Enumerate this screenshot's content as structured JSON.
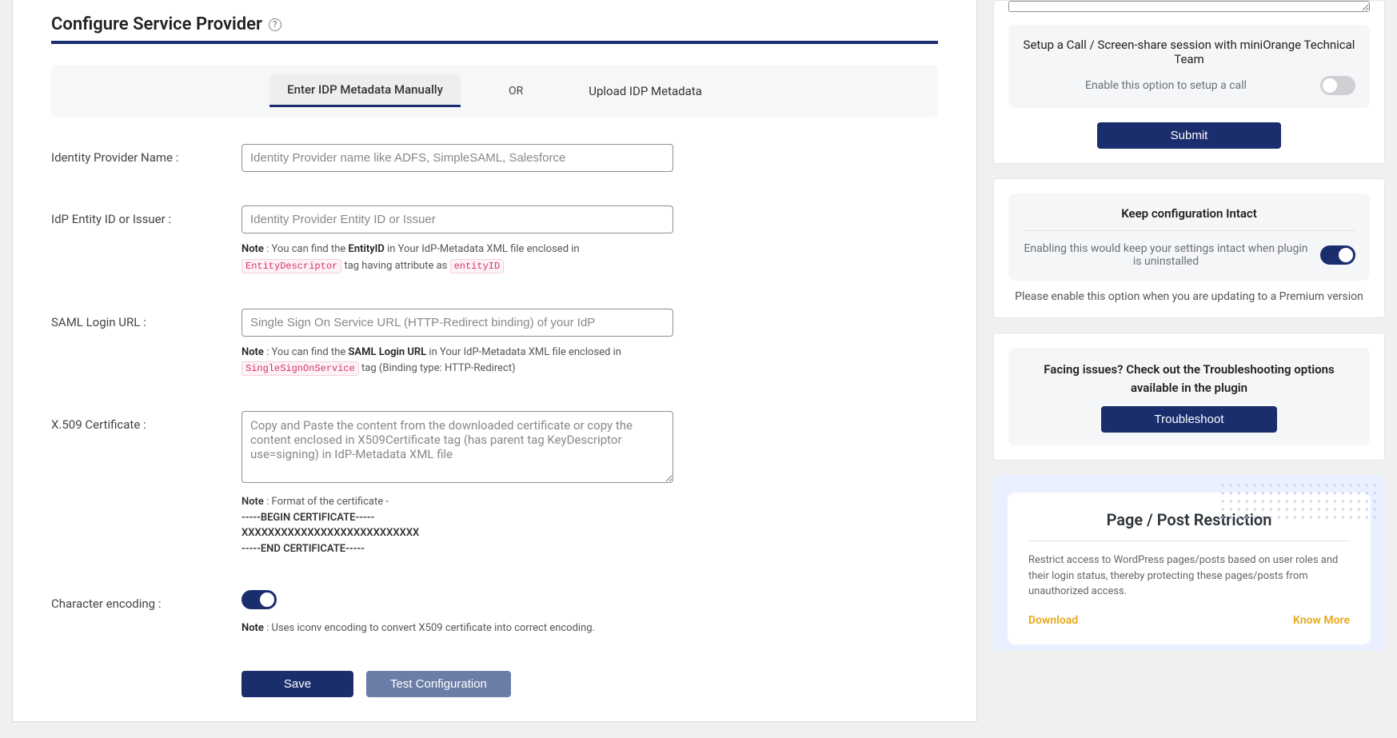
{
  "header": {
    "title": "Configure Service Provider",
    "help_glyph": "?"
  },
  "tabs": {
    "manual": "Enter IDP Metadata Manually",
    "or": "OR",
    "upload": "Upload IDP Metadata"
  },
  "form": {
    "idp_name": {
      "label": "Identity Provider Name :",
      "placeholder": "Identity Provider name like ADFS, SimpleSAML, Salesforce"
    },
    "entity_id": {
      "label": "IdP Entity ID or Issuer :",
      "placeholder": "Identity Provider Entity ID or Issuer",
      "note_prefix": "Note",
      "note_1": " : You can find the ",
      "note_bold": "EntityID",
      "note_2": " in Your IdP-Metadata XML file enclosed in ",
      "note_code1": "EntityDescriptor",
      "note_3": " tag having attribute as ",
      "note_code2": "entityID"
    },
    "login_url": {
      "label": "SAML Login URL :",
      "placeholder": "Single Sign On Service URL (HTTP-Redirect binding) of your IdP",
      "note_prefix": "Note",
      "note_1": " : You can find the ",
      "note_bold": "SAML Login URL",
      "note_2": " in Your IdP-Metadata XML file enclosed in ",
      "note_code": "SingleSignOnService",
      "note_3": " tag (Binding type: HTTP-Redirect)"
    },
    "x509": {
      "label": "X.509 Certificate :",
      "placeholder": "Copy and Paste the content from the downloaded certificate or copy the content enclosed in X509Certificate tag (has parent tag KeyDescriptor use=signing) in IdP-Metadata XML file",
      "note_prefix": "Note",
      "note_text": " : Format of the certificate -",
      "line1": "-----BEGIN CERTIFICATE-----",
      "line2": "XXXXXXXXXXXXXXXXXXXXXXXXXXX",
      "line3": "-----END CERTIFICATE-----"
    },
    "encoding": {
      "label": "Character encoding :",
      "note_prefix": "Note",
      "note_text": " : Uses iconv encoding to convert X509 certificate into correct encoding."
    },
    "buttons": {
      "save": "Save",
      "test": "Test Configuration"
    }
  },
  "side": {
    "call": {
      "heading": "Setup a Call / Screen-share session with miniOrange Technical Team",
      "option_text": "Enable this option to setup a call",
      "submit": "Submit"
    },
    "keep": {
      "heading": "Keep configuration Intact",
      "option_text": "Enabling this would keep your settings intact when plugin is uninstalled",
      "footer": "Please enable this option when you are updating to a Premium version"
    },
    "trouble": {
      "heading": "Facing issues? Check out the Troubleshooting options available in the plugin",
      "button": "Troubleshoot"
    },
    "promo": {
      "title": "Page / Post Restriction",
      "text": "Restrict access to WordPress pages/posts based on user roles and their login status, thereby protecting these pages/posts from unauthorized access.",
      "download": "Download",
      "know_more": "Know More"
    }
  }
}
